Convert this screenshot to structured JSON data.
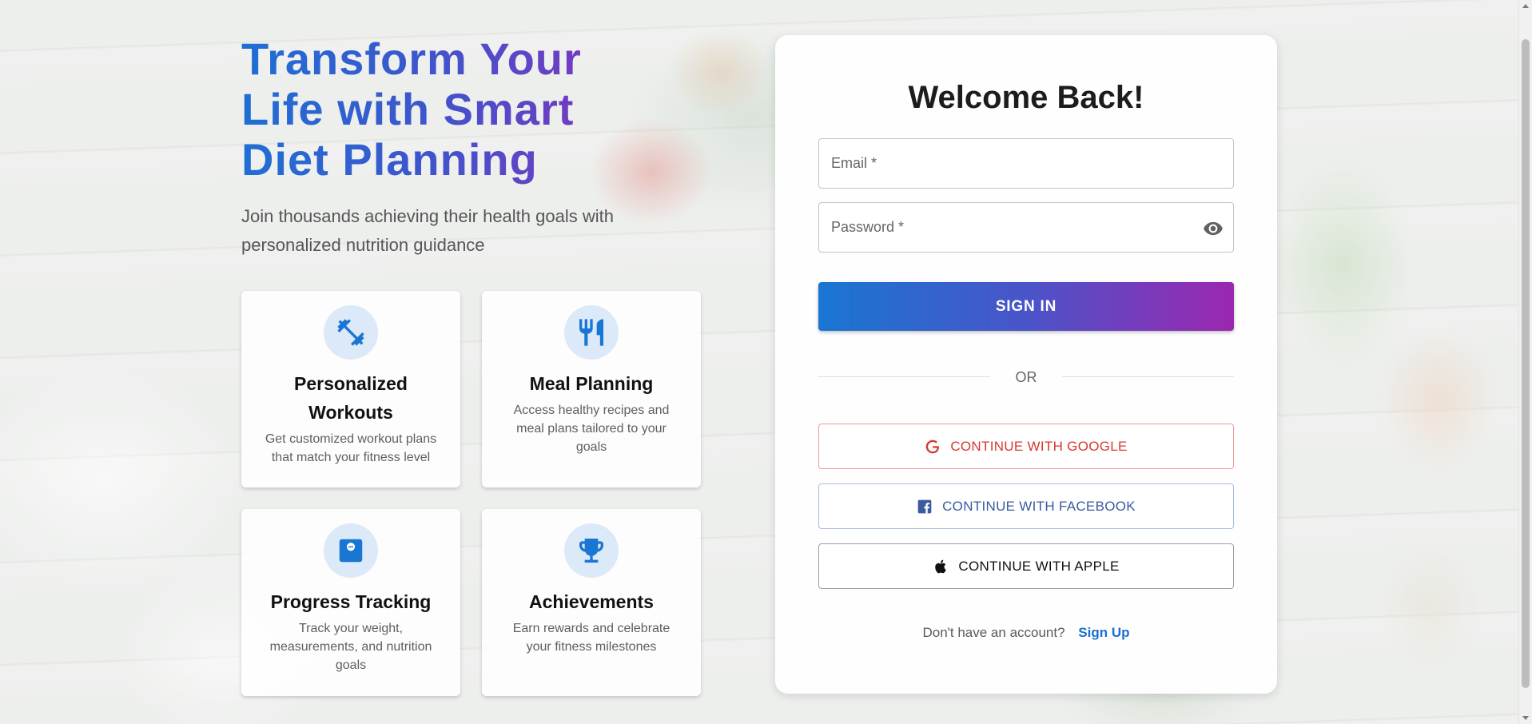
{
  "hero": {
    "title": "Transform Your Life with Smart Diet Planning",
    "subtitle": "Join thousands achieving their health goals with personalized nutrition guidance"
  },
  "features": [
    {
      "icon": "dumbbell-icon",
      "title": "Personalized Workouts",
      "description": "Get customized workout plans that match your fitness level"
    },
    {
      "icon": "fork-knife-icon",
      "title": "Meal Planning",
      "description": "Access healthy recipes and meal plans tailored to your goals"
    },
    {
      "icon": "scale-icon",
      "title": "Progress Tracking",
      "description": "Track your weight, measurements, and nutrition goals"
    },
    {
      "icon": "trophy-icon",
      "title": "Achievements",
      "description": "Earn rewards and celebrate your fitness milestones"
    }
  ],
  "login": {
    "title": "Welcome Back!",
    "email_placeholder": "Email *",
    "password_placeholder": "Password *",
    "signin_label": "SIGN IN",
    "divider": "OR",
    "google_label": "CONTINUE WITH GOOGLE",
    "facebook_label": "CONTINUE WITH FACEBOOK",
    "apple_label": "CONTINUE WITH APPLE",
    "signup_prompt": "Don't have an account?",
    "signup_link": "Sign Up"
  },
  "colors": {
    "primary": "#1976d2",
    "accent": "#9c27b0",
    "google": "#d53a2f",
    "facebook": "#3b5aa0"
  }
}
